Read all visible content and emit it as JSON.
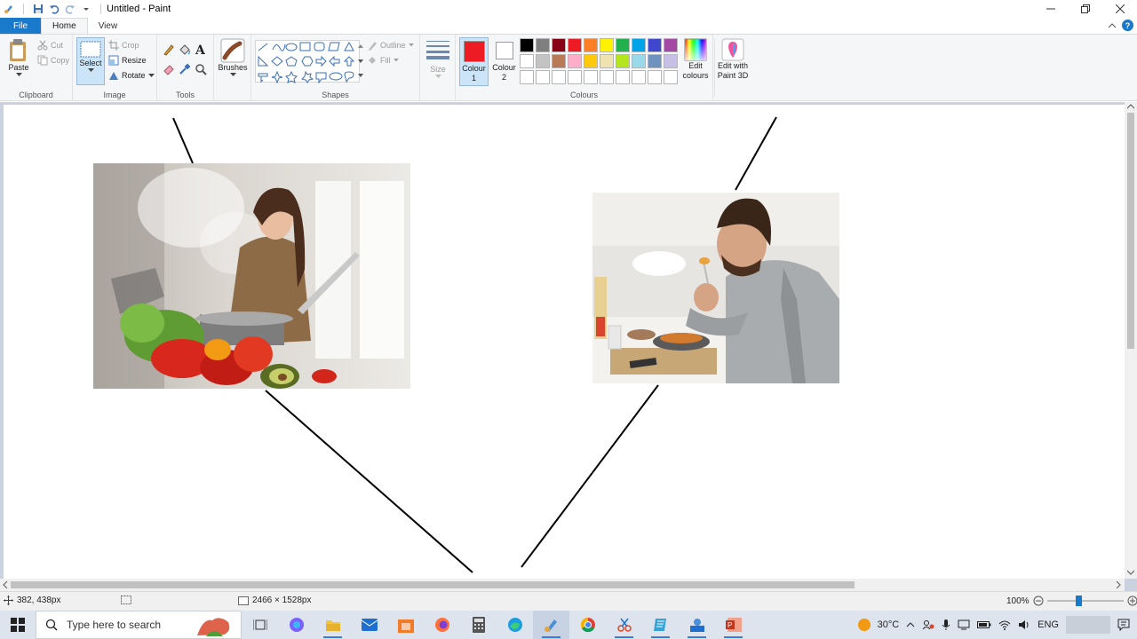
{
  "window": {
    "title": "Untitled - Paint",
    "controls": [
      "minimize",
      "restore",
      "close"
    ]
  },
  "tabs": [
    {
      "label": "File"
    },
    {
      "label": "Home"
    },
    {
      "label": "View"
    }
  ],
  "ribbon": {
    "clipboard": {
      "label": "Clipboard",
      "paste": "Paste",
      "cut": "Cut",
      "copy": "Copy"
    },
    "image": {
      "label": "Image",
      "select": "Select",
      "crop": "Crop",
      "resize": "Resize",
      "rotate": "Rotate"
    },
    "tools": {
      "label": "Tools"
    },
    "brushes": {
      "label": "Brushes"
    },
    "shapes": {
      "label": "Shapes",
      "outline": "Outline",
      "fill": "Fill"
    },
    "size": {
      "label": "Size"
    },
    "colours": {
      "label": "Colours",
      "colour1": "Colour",
      "colour1_num": "1",
      "colour2": "Colour",
      "colour2_num": "2",
      "colour1_value": "#ed1c24",
      "colour2_value": "#ffffff",
      "edit": "Edit colours",
      "paint3d": "Edit with Paint 3D",
      "palette": [
        "#000000",
        "#7f7f7f",
        "#880015",
        "#ed1c24",
        "#ff7f27",
        "#fff200",
        "#22b14c",
        "#00a2e8",
        "#3f48cc",
        "#a349a4",
        "#ffffff",
        "#c3c3c3",
        "#b97a57",
        "#ffaec9",
        "#ffc90e",
        "#efe4b0",
        "#b5e61d",
        "#99d9ea",
        "#7092be",
        "#c8bfe7",
        "#ffffff",
        "#ffffff",
        "#ffffff",
        "#ffffff",
        "#ffffff",
        "#ffffff",
        "#ffffff",
        "#ffffff",
        "#ffffff",
        "#ffffff"
      ]
    }
  },
  "status": {
    "cursor_pos": "382, 438px",
    "image_size": "2466 × 1528px",
    "zoom": "100%"
  },
  "taskbar": {
    "search_placeholder": "Type here to search",
    "temperature": "30°C",
    "language": "ENG"
  }
}
